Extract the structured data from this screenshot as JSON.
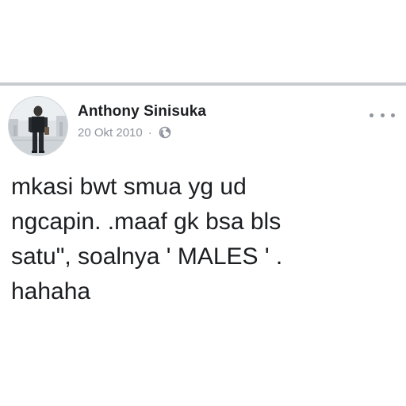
{
  "post": {
    "author": "Anthony Sinisuka",
    "date": "20 Okt 2010",
    "separator": "·",
    "privacy_icon": "globe-icon",
    "more_icon": "more-options-icon",
    "text": "mkasi bwt smua yg ud\nngcapin. .maaf gk bsa bls\nsatu\", soalnya ' MALES ' .\nhahaha"
  }
}
